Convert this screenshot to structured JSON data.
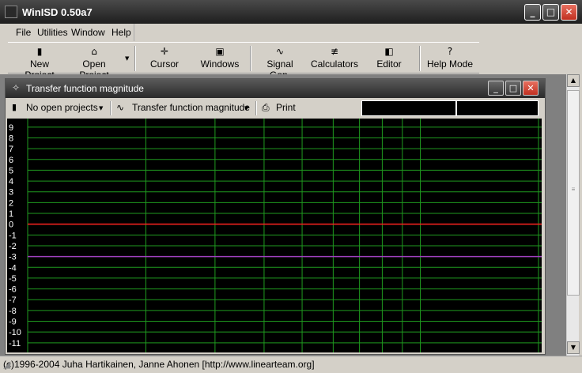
{
  "window": {
    "title": "WinISD 0.50a7"
  },
  "controls": {
    "minimize": "_",
    "maximize": "□",
    "close": "✕"
  },
  "menu": [
    {
      "label": "File"
    },
    {
      "label": "Utilities"
    },
    {
      "label": "Window"
    },
    {
      "label": "Help"
    }
  ],
  "toolbar": [
    {
      "label": "New Project",
      "icon": "new-project-icon",
      "glyph": "▮"
    },
    {
      "label": "Open Project",
      "icon": "open-folder-icon",
      "glyph": "⌂"
    },
    {
      "label": "Cursor",
      "icon": "cursor-icon",
      "glyph": "✛"
    },
    {
      "label": "Windows",
      "icon": "windows-icon",
      "glyph": "▣"
    },
    {
      "label": "Signal Gen.",
      "icon": "signal-icon",
      "glyph": "∿"
    },
    {
      "label": "Calculators",
      "icon": "calculator-icon",
      "glyph": "≢"
    },
    {
      "label": "Editor",
      "icon": "editor-icon",
      "glyph": "◧"
    },
    {
      "label": "Help Mode",
      "icon": "help-icon",
      "glyph": "?"
    }
  ],
  "child_window": {
    "title": "Transfer function magnitude",
    "project_select": "No open projects",
    "plot_select": "Transfer function magnitude",
    "print_label": "Print"
  },
  "chart_data": {
    "type": "line",
    "yticks": [
      "9",
      "8",
      "7",
      "6",
      "5",
      "4",
      "3",
      "2",
      "1",
      "0",
      "-1",
      "-2",
      "-3",
      "-4",
      "-5",
      "-6",
      "-7",
      "-8",
      "-9",
      "-10",
      "-11"
    ],
    "ylim": [
      -11.5,
      9.5
    ],
    "xlim": [
      10,
      200
    ],
    "x_scale": "log",
    "grid": true,
    "reference_lines": [
      {
        "y": 0,
        "color": "#ff2020"
      },
      {
        "y": -3,
        "color": "#a040c0"
      }
    ],
    "grid_color": "#1f9a1f",
    "background": "#000000"
  },
  "status": {
    "text": "(c)1996-2004 Juha Hartikainen, Janne Ahonen [http://www.linearteam.org]"
  }
}
